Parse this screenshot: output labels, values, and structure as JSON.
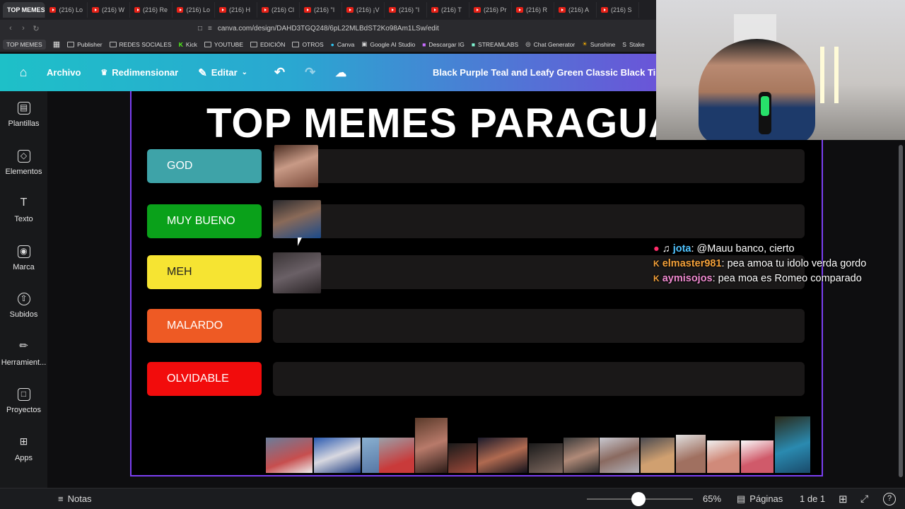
{
  "browser": {
    "active_tab": "TOP MEMES",
    "tabs": [
      "(216) Lo",
      "(216) W",
      "(216) Re",
      "(216) Lo",
      "(216) H",
      "(216) Cl",
      "(216) \"I",
      "(216) ¡V",
      "(216) \"I",
      "(216) T",
      "(216) Pr",
      "(216) R",
      "(216) A",
      "(216) S"
    ],
    "url": "canva.com/design/DAHD3TGQ248/6pL22MLBdST2Ko98Am1LSw/edit",
    "bookmarks": [
      "TOP MEMES",
      "Publisher",
      "REDES SOCIALES",
      "Kick",
      "YOUTUBE",
      "EDICIÓN",
      "OTROS",
      "Canva",
      "Google AI Studio",
      "Descargar IG",
      "STREAMLABS",
      "Chat Generator",
      "Sunshine",
      "Stake"
    ]
  },
  "toolbar": {
    "archivo": "Archivo",
    "redimensionar": "Redimensionar",
    "editar": "Editar",
    "doc_title": "Black Purple Teal and Leafy Green Classic Black Ti"
  },
  "sidebar": {
    "items": [
      {
        "label": "Plantillas",
        "icon": "templates-icon"
      },
      {
        "label": "Elementos",
        "icon": "elements-icon"
      },
      {
        "label": "Texto",
        "icon": "text-icon"
      },
      {
        "label": "Marca",
        "icon": "brand-icon"
      },
      {
        "label": "Subidos",
        "icon": "uploads-icon"
      },
      {
        "label": "Herramient...",
        "icon": "tools-icon"
      },
      {
        "label": "Proyectos",
        "icon": "projects-icon"
      },
      {
        "label": "Apps",
        "icon": "apps-icon"
      }
    ]
  },
  "design": {
    "title": "TOP MEMES PARAGUA",
    "tiers": [
      {
        "label": "GOD",
        "color": "#3ea3a8"
      },
      {
        "label": "MUY BUENO",
        "color": "#0aa11a"
      },
      {
        "label": "MEH",
        "color": "#f6e432"
      },
      {
        "label": "MALARDO",
        "color": "#ee5a24"
      },
      {
        "label": "OLVIDABLE",
        "color": "#f20c0c"
      }
    ]
  },
  "chat": [
    {
      "user": "jota",
      "msg": ": @Mauu banco, cierto"
    },
    {
      "user": "elmaster981",
      "msg": ": pea amoa tu idolo verda gordo"
    },
    {
      "user": "aymisojos",
      "msg": ": pea moa es Romeo comparado"
    }
  ],
  "bottom": {
    "notas": "Notas",
    "zoom": "65%",
    "paginas": "Páginas",
    "page_count": "1 de 1"
  }
}
